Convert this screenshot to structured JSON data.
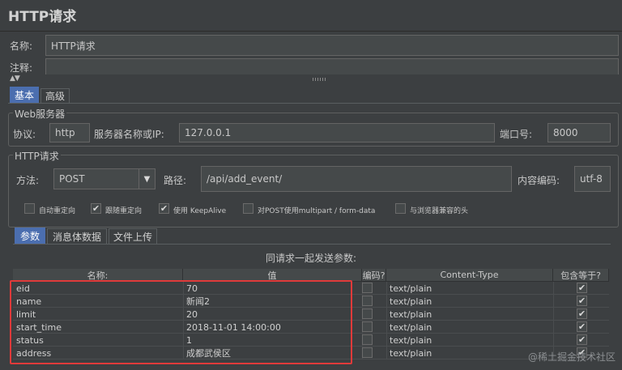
{
  "title": "HTTP请求",
  "name_label": "名称:",
  "name_value": "HTTP请求",
  "comment_label": "注释:",
  "tabs_top": [
    "基本",
    "高级"
  ],
  "web_server": {
    "group": "Web服务器",
    "protocol_label": "协议:",
    "protocol_value": "http",
    "host_label": "服务器名称或IP:",
    "host_value": "127.0.0.1",
    "port_label": "端口号:",
    "port_value": "8000"
  },
  "http_request": {
    "group": "HTTP请求",
    "method_label": "方法:",
    "method_value": "POST",
    "path_label": "路径:",
    "path_value": "/api/add_event/",
    "encoding_label": "内容编码:",
    "encoding_value": "utf-8"
  },
  "options": [
    {
      "label": "自动重定向",
      "checked": false
    },
    {
      "label": "跟随重定向",
      "checked": true
    },
    {
      "label": "使用 KeepAlive",
      "checked": true
    },
    {
      "label": "对POST使用multipart / form-data",
      "checked": false
    },
    {
      "label": "与浏览器兼容的头",
      "checked": false
    }
  ],
  "sub_tabs": [
    "参数",
    "消息体数据",
    "文件上传"
  ],
  "params_caption": "同请求一起发送参数:",
  "columns": [
    "名称:",
    "值",
    "编码?",
    "Content-Type",
    "包含等于?"
  ],
  "rows": [
    {
      "name": "eid",
      "value": "70",
      "encode": false,
      "ctype": "text/plain",
      "include": true
    },
    {
      "name": "name",
      "value": "新闻2",
      "encode": false,
      "ctype": "text/plain",
      "include": true
    },
    {
      "name": "limit",
      "value": "20",
      "encode": false,
      "ctype": "text/plain",
      "include": true
    },
    {
      "name": "start_time",
      "value": "2018-11-01 14:00:00",
      "encode": false,
      "ctype": "text/plain",
      "include": true
    },
    {
      "name": "status",
      "value": "1",
      "encode": false,
      "ctype": "text/plain",
      "include": true
    },
    {
      "name": "address",
      "value": "成都武侯区",
      "encode": false,
      "ctype": "text/plain",
      "include": true
    }
  ],
  "watermark": "@稀土掘金技术社区",
  "colors": {
    "tab_active": "#4b6eaf",
    "highlight_box": "#e03a3a"
  }
}
